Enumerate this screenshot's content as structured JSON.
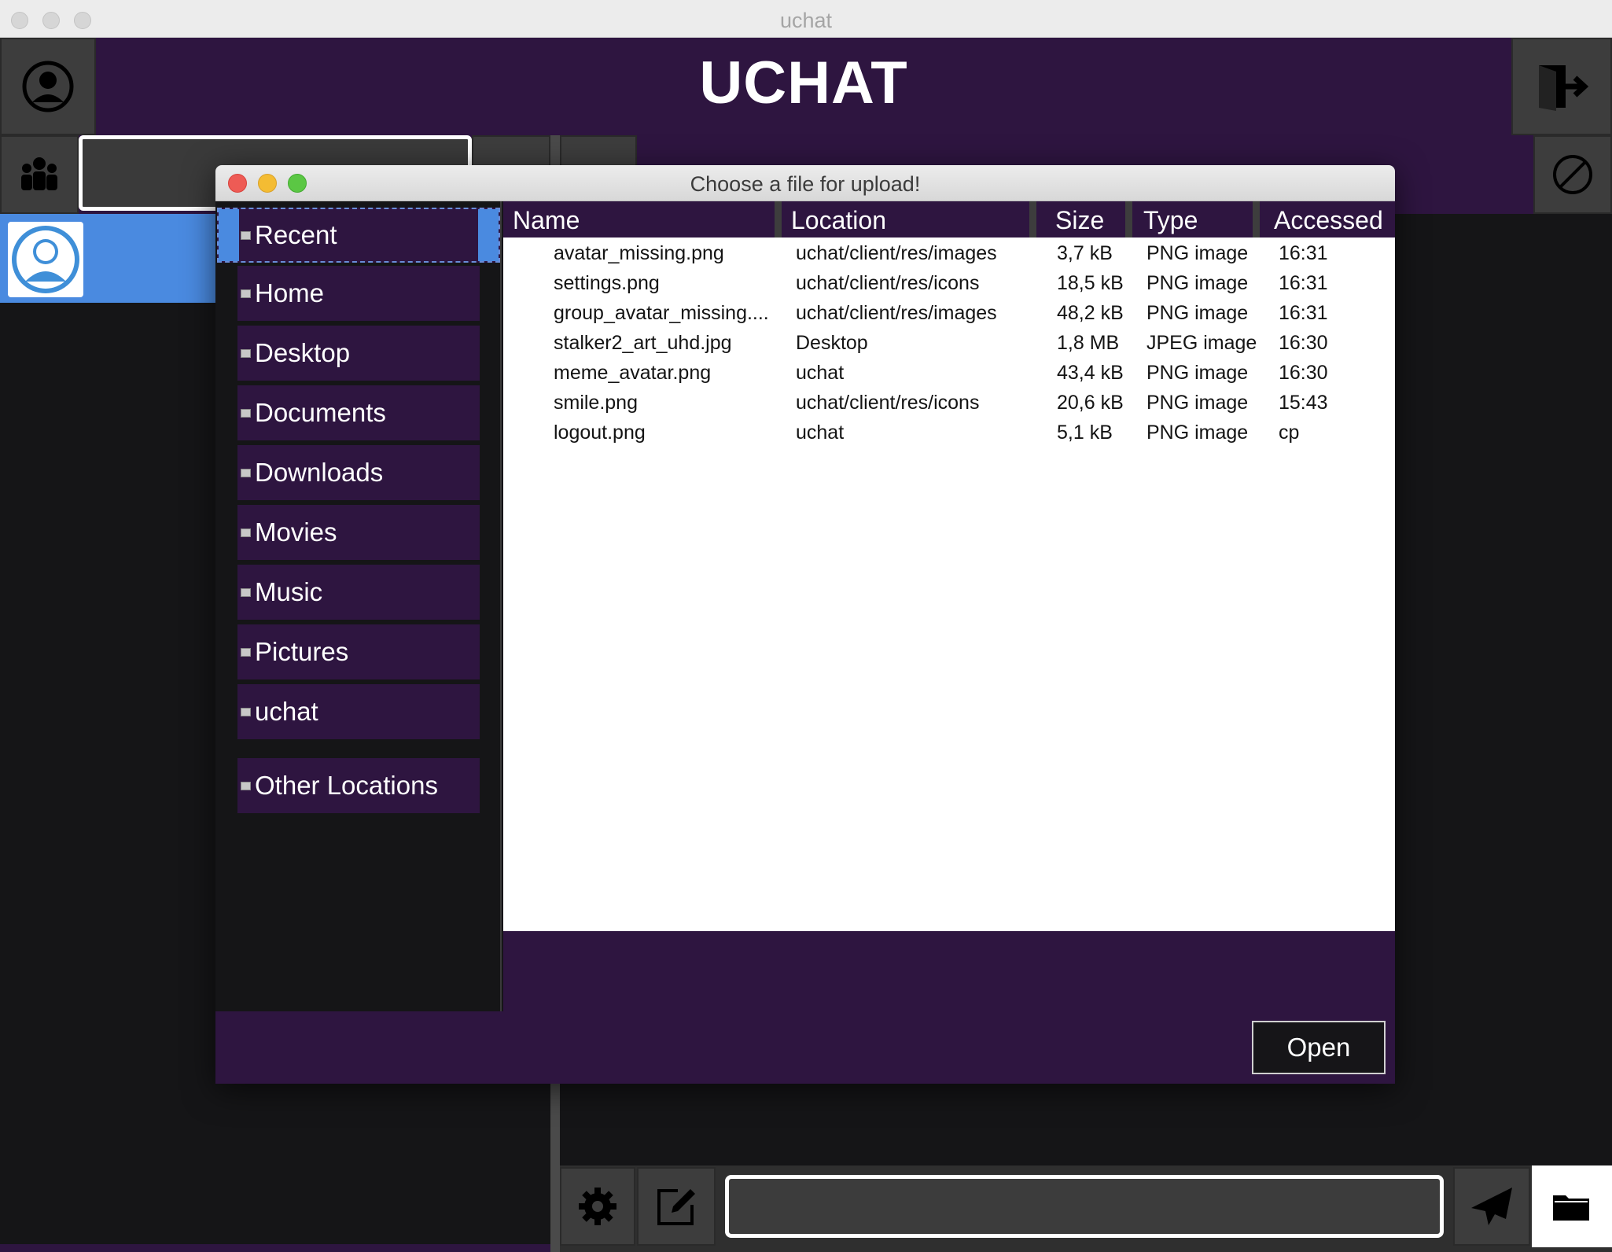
{
  "window": {
    "title": "uchat"
  },
  "app": {
    "title": "UCHAT"
  },
  "colors": {
    "brand_purple": "#2e1540",
    "selection_blue": "#4a8ae0",
    "panel_dark": "#151517"
  },
  "icons": [
    "profile-icon",
    "group-icon",
    "logout-icon",
    "block-icon",
    "settings-icon",
    "edit-icon",
    "send-icon",
    "folder-icon",
    "avatar-icon"
  ],
  "dialog": {
    "title": "Choose a file for upload!",
    "places": [
      {
        "label": "Recent",
        "selected": true
      },
      {
        "label": "Home"
      },
      {
        "label": "Desktop"
      },
      {
        "label": "Documents"
      },
      {
        "label": "Downloads"
      },
      {
        "label": "Movies"
      },
      {
        "label": "Music"
      },
      {
        "label": "Pictures"
      },
      {
        "label": "uchat"
      },
      {
        "label": "Other Locations"
      }
    ],
    "columns": [
      "Name",
      "Location",
      "Size",
      "Type",
      "Accessed"
    ],
    "files": [
      {
        "name": "avatar_missing.png",
        "location": "uchat/client/res/images",
        "size": "3,7 kB",
        "type": "PNG image",
        "accessed": "16:31"
      },
      {
        "name": "settings.png",
        "location": "uchat/client/res/icons",
        "size": "18,5 kB",
        "type": "PNG image",
        "accessed": "16:31"
      },
      {
        "name": "group_avatar_missing....",
        "location": "uchat/client/res/images",
        "size": "48,2 kB",
        "type": "PNG image",
        "accessed": "16:31"
      },
      {
        "name": "stalker2_art_uhd.jpg",
        "location": "Desktop",
        "size": "1,8 MB",
        "type": "JPEG image",
        "accessed": "16:30"
      },
      {
        "name": "meme_avatar.png",
        "location": "uchat",
        "size": "43,4 kB",
        "type": "PNG image",
        "accessed": "16:30"
      },
      {
        "name": "smile.png",
        "location": "uchat/client/res/icons",
        "size": "20,6 kB",
        "type": "PNG image",
        "accessed": "15:43"
      },
      {
        "name": "logout.png",
        "location": "uchat",
        "size": "5,1 kB",
        "type": "PNG image",
        "accessed": "cp"
      }
    ],
    "open_label": "Open"
  }
}
